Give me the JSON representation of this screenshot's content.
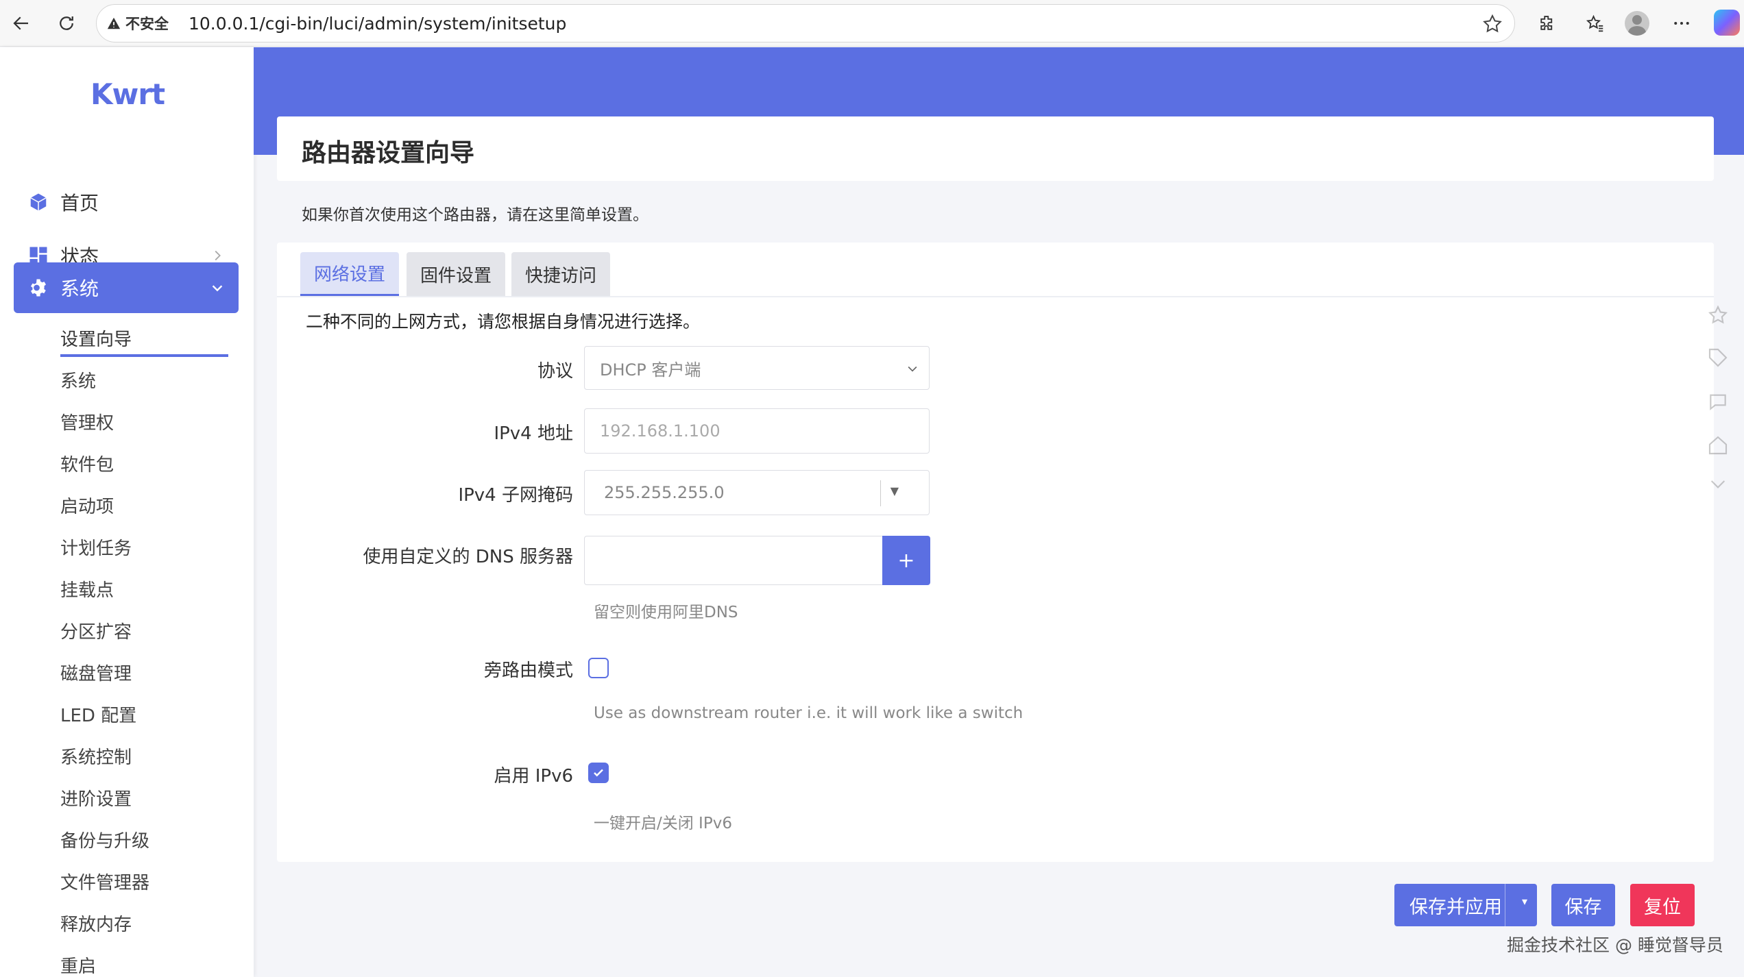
{
  "browser": {
    "insecure_label": "不安全",
    "url": "10.0.0.1/cgi-bin/luci/admin/system/initsetup"
  },
  "sidebar": {
    "logo": "Kwrt",
    "menu": [
      {
        "label": "首页",
        "icon": "cube-icon"
      },
      {
        "label": "状态",
        "icon": "dashboard-icon"
      },
      {
        "label": "系统",
        "icon": "gear-icon",
        "active": true
      }
    ],
    "submenu": [
      "设置向导",
      "系统",
      "管理权",
      "软件包",
      "启动项",
      "计划任务",
      "挂载点",
      "分区扩容",
      "磁盘管理",
      "LED 配置",
      "系统控制",
      "进阶设置",
      "备份与升级",
      "文件管理器",
      "释放内存",
      "重启"
    ],
    "current_sub": "设置向导"
  },
  "page": {
    "title": "路由器设置向导",
    "description": "如果你首次使用这个路由器，请在这里简单设置。"
  },
  "tabs": [
    "网络设置",
    "固件设置",
    "快捷访问"
  ],
  "active_tab": "网络设置",
  "form": {
    "section_desc": "二种不同的上网方式，请您根据自身情况进行选择。",
    "protocol": {
      "label": "协议",
      "value": "DHCP 客户端"
    },
    "ipv4_addr": {
      "label": "IPv4 地址",
      "placeholder": "192.168.1.100"
    },
    "ipv4_mask": {
      "label": "IPv4 子网掩码",
      "value": "255.255.255.0"
    },
    "dns": {
      "label": "使用自定义的 DNS 服务器",
      "add": "+",
      "hint": "留空则使用阿里DNS"
    },
    "bypass": {
      "label": "旁路由模式",
      "checked": false,
      "hint": "Use as downstream router i.e. it will work like a switch"
    },
    "ipv6": {
      "label": "启用 IPv6",
      "checked": true,
      "hint": "一键开启/关闭 IPv6"
    }
  },
  "actions": {
    "save_apply": "保存并应用",
    "dropdown": "▾",
    "save": "保存",
    "reset": "复位"
  },
  "watermark": "掘金技术社区 @ 睡觉督导员",
  "colors": {
    "accent": "#5b6fe2",
    "danger": "#f0365a"
  }
}
